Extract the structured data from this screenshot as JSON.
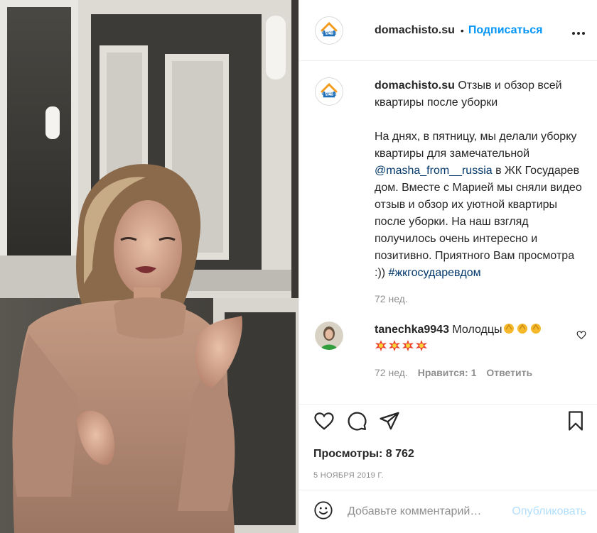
{
  "post": {
    "username": "domachisto.su",
    "separator": "•",
    "follow_label": "Подписаться",
    "more_label": "•••",
    "logo_text": "ЧИСТО"
  },
  "caption": {
    "username": "domachisto.su",
    "title": "Отзыв и обзор всей квартиры после уборки",
    "text_before_mention": "На днях, в пятницу, мы делали уборку квартиры для замечательной ",
    "mention": "@masha_from__russia",
    "text_after_mention": " в ЖК Государев дом. Вместе с Марией мы сняли видео отзыв и обзор их уютной квартиры после уборки. На наш взгляд получилось очень интересно и позитивно. Приятного Вам просмотра :)) ",
    "hashtag": "#жкгосударевдом",
    "time": "72 нед."
  },
  "comment": {
    "username": "tanechka9943",
    "text": "Молодцы",
    "time": "72 нед.",
    "likes": "Нравится: 1",
    "reply": "Ответить"
  },
  "stats": {
    "views": "Просмотры: 8 762",
    "date": "5 НОЯБРЯ 2019 Г."
  },
  "add_comment": {
    "placeholder": "Добавьте комментарий…",
    "post_label": "Опубликовать"
  },
  "colors": {
    "link": "#00376b",
    "follow": "#0095f6",
    "muted": "#8e8e8e",
    "post_disabled": "#b2dffc"
  },
  "icons": {
    "like": "heart-icon",
    "comment": "comment-icon",
    "share": "share-icon",
    "save": "bookmark-icon",
    "emoji": "emoji-icon",
    "more": "more-icon"
  }
}
